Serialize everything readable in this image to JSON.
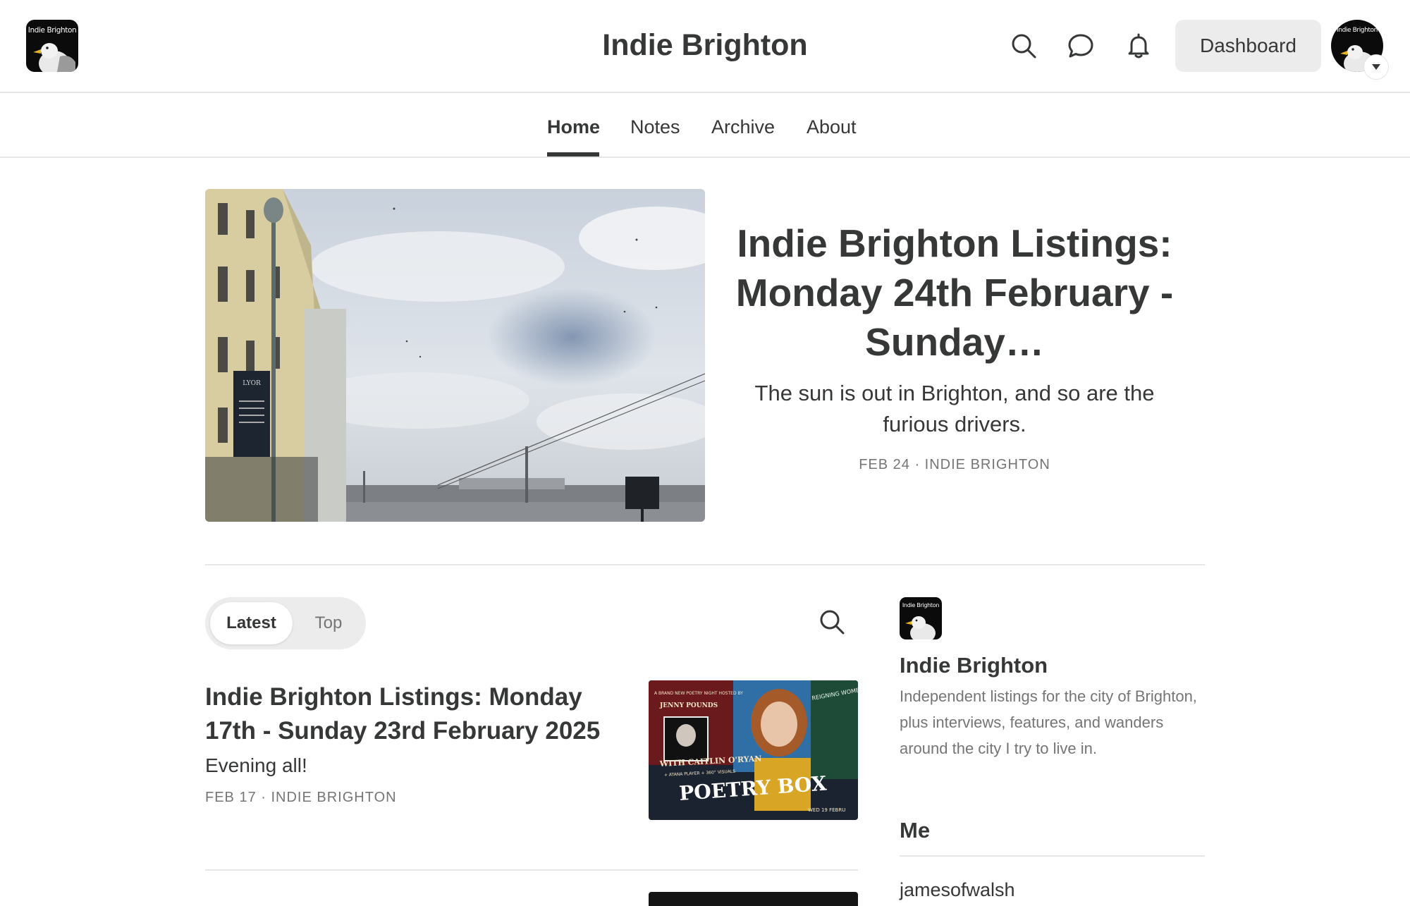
{
  "header": {
    "logo_text": "Indie Brighton",
    "site_title": "Indie Brighton",
    "icons": [
      "search-icon",
      "chat-icon",
      "bell-icon"
    ],
    "dashboard_label": "Dashboard",
    "avatar_text": "Indie Brighton"
  },
  "nav": {
    "tabs": [
      {
        "label": "Home",
        "active": true
      },
      {
        "label": "Notes",
        "active": false
      },
      {
        "label": "Archive",
        "active": false
      },
      {
        "label": "About",
        "active": false
      }
    ]
  },
  "hero": {
    "title": "Indie Brighton Listings: Monday 24th February - Sunday…",
    "subtitle": "The sun is out in Brighton, and so are the furious drivers.",
    "meta": "FEB 24 · INDIE BRIGHTON",
    "image_sign_text": "LYOR"
  },
  "feed": {
    "toggle": [
      {
        "label": "Latest",
        "active": true
      },
      {
        "label": "Top",
        "active": false
      }
    ],
    "posts": [
      {
        "title": "Indie Brighton Listings: Monday 17th - Sunday 23rd February 2025",
        "subtitle": "Evening all!",
        "meta": "FEB 17 · INDIE BRIGHTON",
        "thumb_text": {
          "headline": "POETRY BOX",
          "host_line": "A BRAND NEW POETRY NIGHT HOSTED BY",
          "host_name": "JENNY POUNDS",
          "guest": "WITH CAITLIN O'RYAN",
          "guest_sub": "+ ATANA PLAYER + 360° VISUALS",
          "side_text": "REIGNING WOMEN",
          "date": "WED 19 FEBRU"
        }
      }
    ]
  },
  "sidebar": {
    "logo_text": "Indie Brighton",
    "name": "Indie Brighton",
    "description": "Independent listings for the city of Brighton, plus interviews, features, and wanders around the city I try to live in.",
    "section_title": "Me",
    "user": "jamesofwalsh"
  },
  "colors": {
    "text": "#363737",
    "muted": "#757575",
    "divider": "#e6e6e6",
    "button_bg": "#ececec"
  }
}
